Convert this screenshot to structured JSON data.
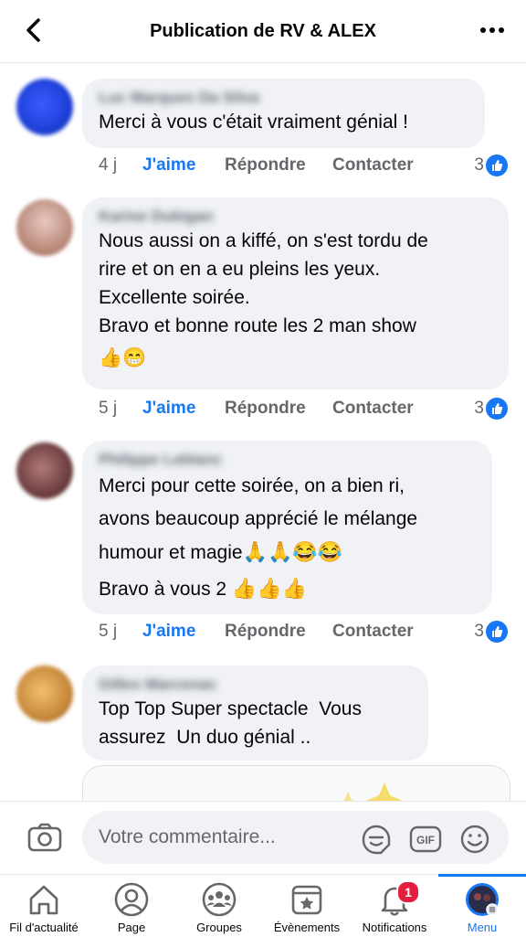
{
  "header": {
    "title": "Publication de RV & ALEX"
  },
  "comments": [
    {
      "name": "Luc Marques Da Silva",
      "text": "Merci à vous c'était vraiment génial !",
      "time": "4 j",
      "like": "J'aime",
      "reply": "Répondre",
      "contact": "Contacter",
      "count": "3",
      "avatar_color": "#1e3fd6"
    },
    {
      "name": "Karine Dubigan",
      "text": "Nous aussi on a kiffé, on s'est tordu de\nrire et on en a eu pleins les yeux.\nExcellente soirée.\nBravo et bonne route les 2 man show",
      "emoji": "👍😁",
      "time": "5 j",
      "like": "J'aime",
      "reply": "Répondre",
      "contact": "Contacter",
      "count": "3",
      "avatar_color": "#c9a49a"
    },
    {
      "name": "Philippe Leblanc",
      "text": "Merci pour cette soirée, on a bien ri,\navons beaucoup apprécié le mélange\nhumour et magie",
      "emoji_inline": "🙏🙏😂😂",
      "text2": "Bravo à vous 2 ",
      "emoji2": "👍👍👍",
      "time": "5 j",
      "like": "J'aime",
      "reply": "Répondre",
      "contact": "Contacter",
      "count": "3",
      "avatar_color": "#8a5a5a"
    },
    {
      "name": "Gilles Marcenac",
      "text": "Top Top Super spectacle  Vous\nassurez  Un duo génial ..",
      "avatar_color": "#c8883a"
    }
  ],
  "composer": {
    "placeholder": "Votre commentaire..."
  },
  "tabs": [
    {
      "label": "Fil d'actualité",
      "icon": "home-icon"
    },
    {
      "label": "Page",
      "icon": "person-icon"
    },
    {
      "label": "Groupes",
      "icon": "groups-icon"
    },
    {
      "label": "Évènements",
      "icon": "calendar-icon"
    },
    {
      "label": "Notifications",
      "icon": "bell-icon",
      "badge": "1"
    },
    {
      "label": "Menu",
      "icon": "profile-menu-icon",
      "active": true
    }
  ],
  "colors": {
    "accent": "#1877f2",
    "bubble": "#f0f2f5",
    "badge": "#e41e3f"
  }
}
